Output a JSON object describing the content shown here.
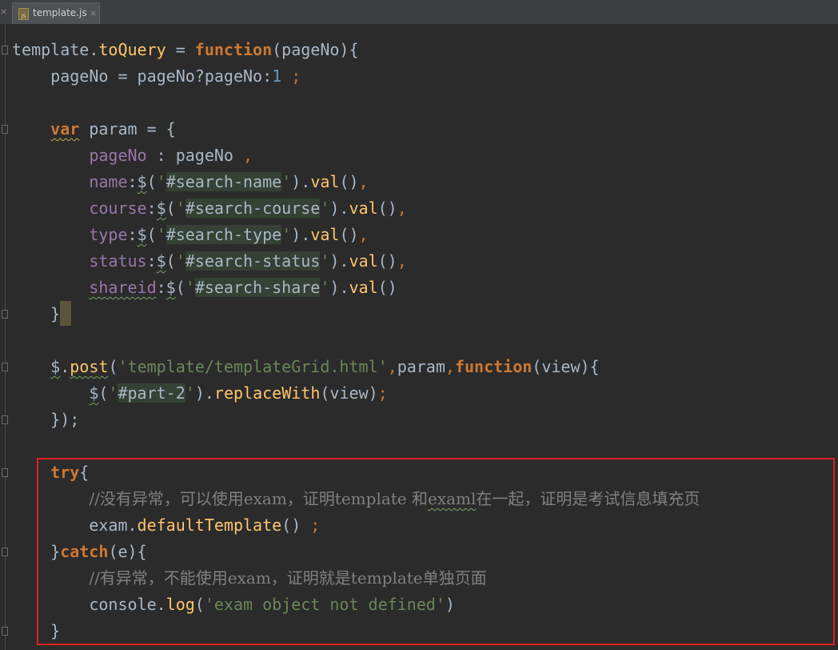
{
  "tab": {
    "title": "template.js",
    "icon": "js-file-icon",
    "icon_label": "JS",
    "close": "×",
    "left_close": "×"
  },
  "code": {
    "l1_obj": "template.",
    "l1_fn": "toQuery",
    "l1_eq": " = ",
    "l1_kw": "function",
    "l1_rest": "(pageNo){",
    "l2_a": "    pageNo = pageNo?pageNo:",
    "l2_num": "1",
    "l2_semi": " ;",
    "l4_kw": "var",
    "l4_rest": " param = {",
    "l5_prop": "pageNo",
    "l5_rest": " : pageNo ",
    "l5_comma": ",",
    "l6_prop": "name",
    "l6_a": ":",
    "l6_dollar": "$",
    "l6_b": "(",
    "l6_q1": "'",
    "l6_sel": "#search-name",
    "l6_q2": "'",
    "l6_c": ").",
    "l6_fn": "val",
    "l6_d": "()",
    "l6_comma": ",",
    "l7_prop": "course",
    "l7_sel": "#search-course",
    "l8_prop": "type",
    "l8_sel": "#search-type",
    "l9_prop": "status",
    "l9_sel": "#search-status",
    "l10_prop": "shareid",
    "l10_sel": "#search-share",
    "l11_brace": "}",
    "l13_dollar": "$",
    "l13_dot": ".",
    "l13_fn": "post",
    "l13_a": "(",
    "l13_str": "'template/templateGrid.html'",
    "l13_c1": ",",
    "l13_b": "param",
    "l13_c2": ",",
    "l13_kw": "function",
    "l13_rest": "(view){",
    "l14_dollar": "$",
    "l14_sel": "#part-2",
    "l14_fn": "replaceWith",
    "l14_rest": "(view)",
    "l14_semi": ";",
    "l15_a": "});",
    "l17_kw": "try",
    "l17_rest": "{",
    "l18_c1": "//没有异常，可以使用exam，证明template 和",
    "l18_sq": "examl",
    "l18_c2": "在一起，证明是考试信息填充页",
    "l19_obj": "exam.",
    "l19_fn": "defaultTemplate",
    "l19_rest": "() ",
    "l19_semi": ";",
    "l20_a": "}",
    "l20_kw": "catch",
    "l20_rest": "(e){",
    "l21_cmt": "//有异常，不能使用exam，证明就是template单独页面",
    "l22_obj": "console.",
    "l22_fn": "log",
    "l22_a": "(",
    "l22_str": "'exam object not defined'",
    "l22_b": ")",
    "l23_brace": "}"
  }
}
